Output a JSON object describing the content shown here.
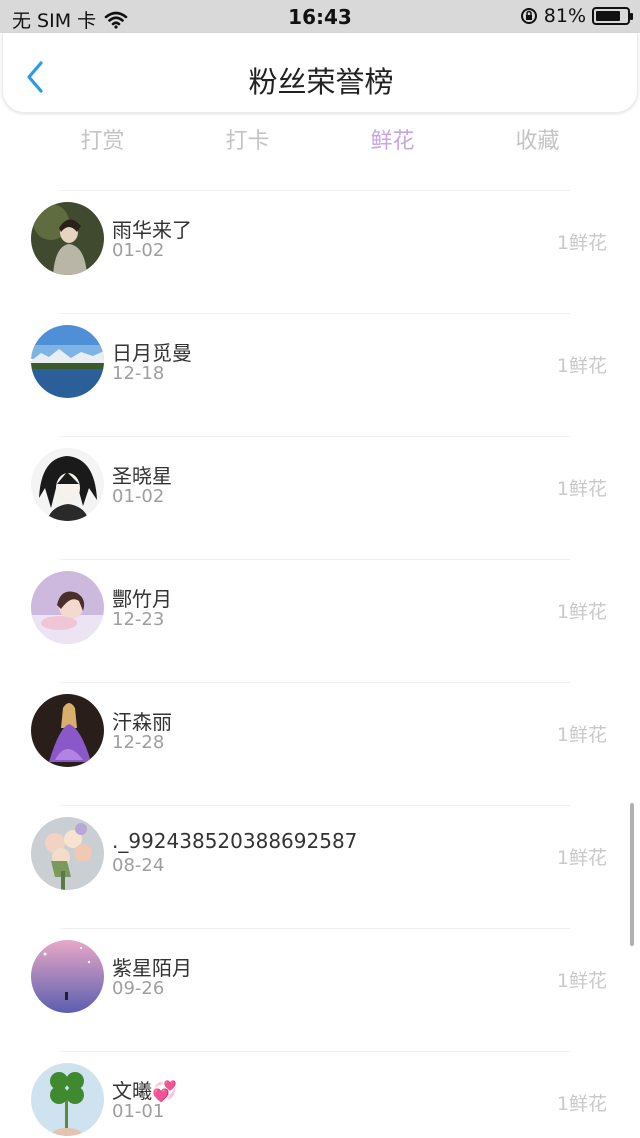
{
  "status_bar": {
    "carrier": "无 SIM 卡",
    "time": "16:43",
    "battery": "81%",
    "battery_level": 0.81
  },
  "header": {
    "title": "粉丝荣誉榜"
  },
  "tabs": [
    {
      "label": "打赏",
      "active": false
    },
    {
      "label": "打卡",
      "active": false
    },
    {
      "label": "鲜花",
      "active": true
    },
    {
      "label": "收藏",
      "active": false
    }
  ],
  "fans": [
    {
      "name": "雨华来了",
      "date": "01-02",
      "amount": "1鲜花"
    },
    {
      "name": "日月觅曼",
      "date": "12-18",
      "amount": "1鲜花"
    },
    {
      "name": "圣晓星",
      "date": "01-02",
      "amount": "1鲜花"
    },
    {
      "name": "酆竹月",
      "date": "12-23",
      "amount": "1鲜花"
    },
    {
      "name": "汗森丽",
      "date": "12-28",
      "amount": "1鲜花"
    },
    {
      "name": "._992438520388692587",
      "date": "08-24",
      "amount": "1鲜花"
    },
    {
      "name": "紫星陌月",
      "date": "09-26",
      "amount": "1鲜花"
    },
    {
      "name": "文曦💞",
      "date": "01-01",
      "amount": "1鲜花"
    }
  ],
  "colors": {
    "accent": "#c7a6e6",
    "back_icon": "#2a9be8"
  }
}
